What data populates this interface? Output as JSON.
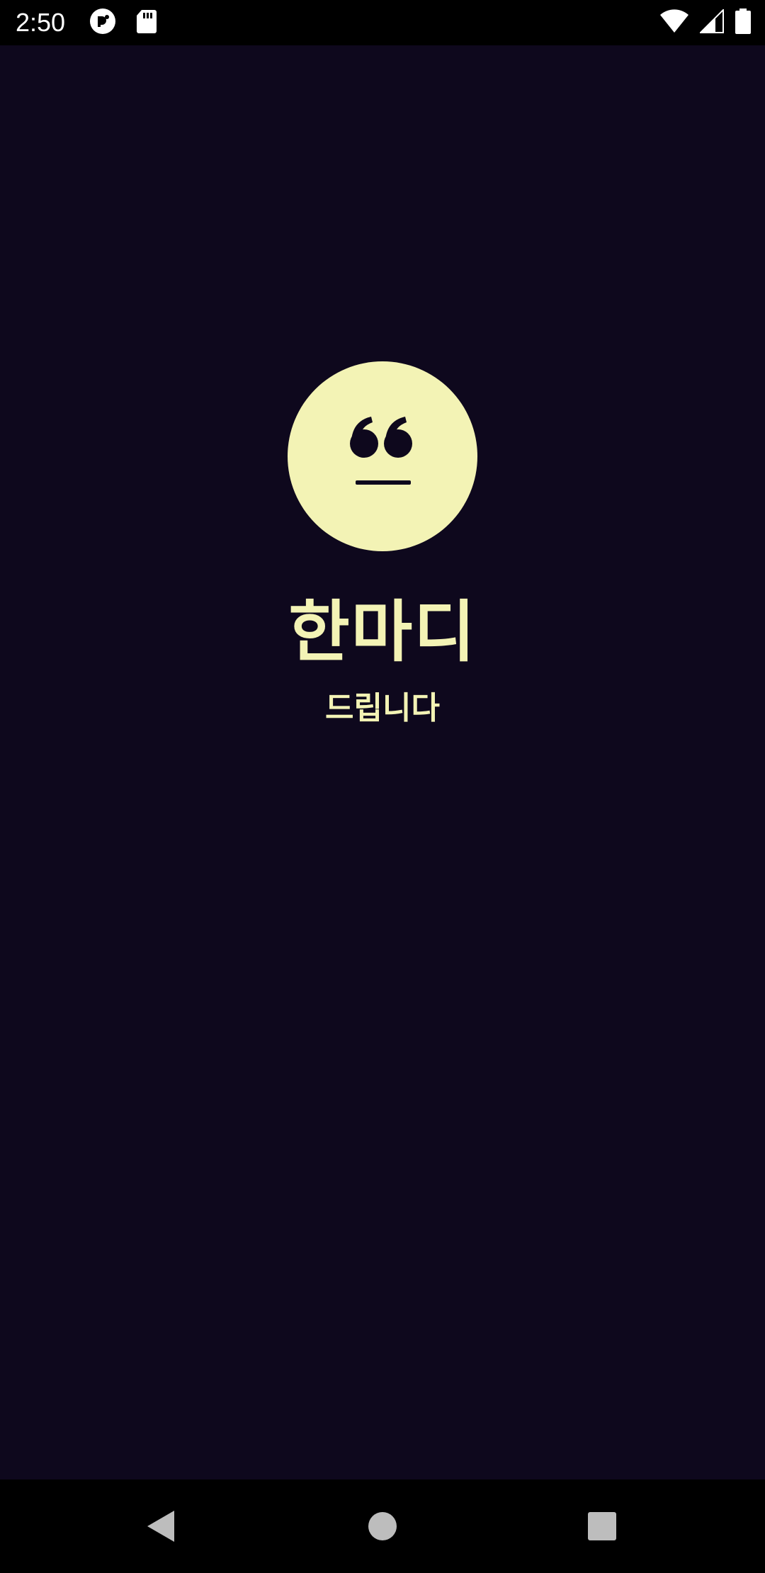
{
  "status_bar": {
    "time": "2:50",
    "left_icons": [
      "pocket-casts-icon",
      "sd-card-icon"
    ],
    "right_icons": [
      "wifi-icon",
      "cell-signal-icon",
      "battery-icon"
    ]
  },
  "splash": {
    "logo_icon": "quote-mark-icon",
    "title": "한마디",
    "subtitle": "드립니다"
  },
  "nav_bar": {
    "buttons": [
      "back-icon",
      "home-icon",
      "recents-icon"
    ]
  },
  "colors": {
    "background": "#0e081d",
    "accent": "#f3f3b5",
    "logo_glyph": "#0e081d",
    "system_bars": "#000000"
  }
}
